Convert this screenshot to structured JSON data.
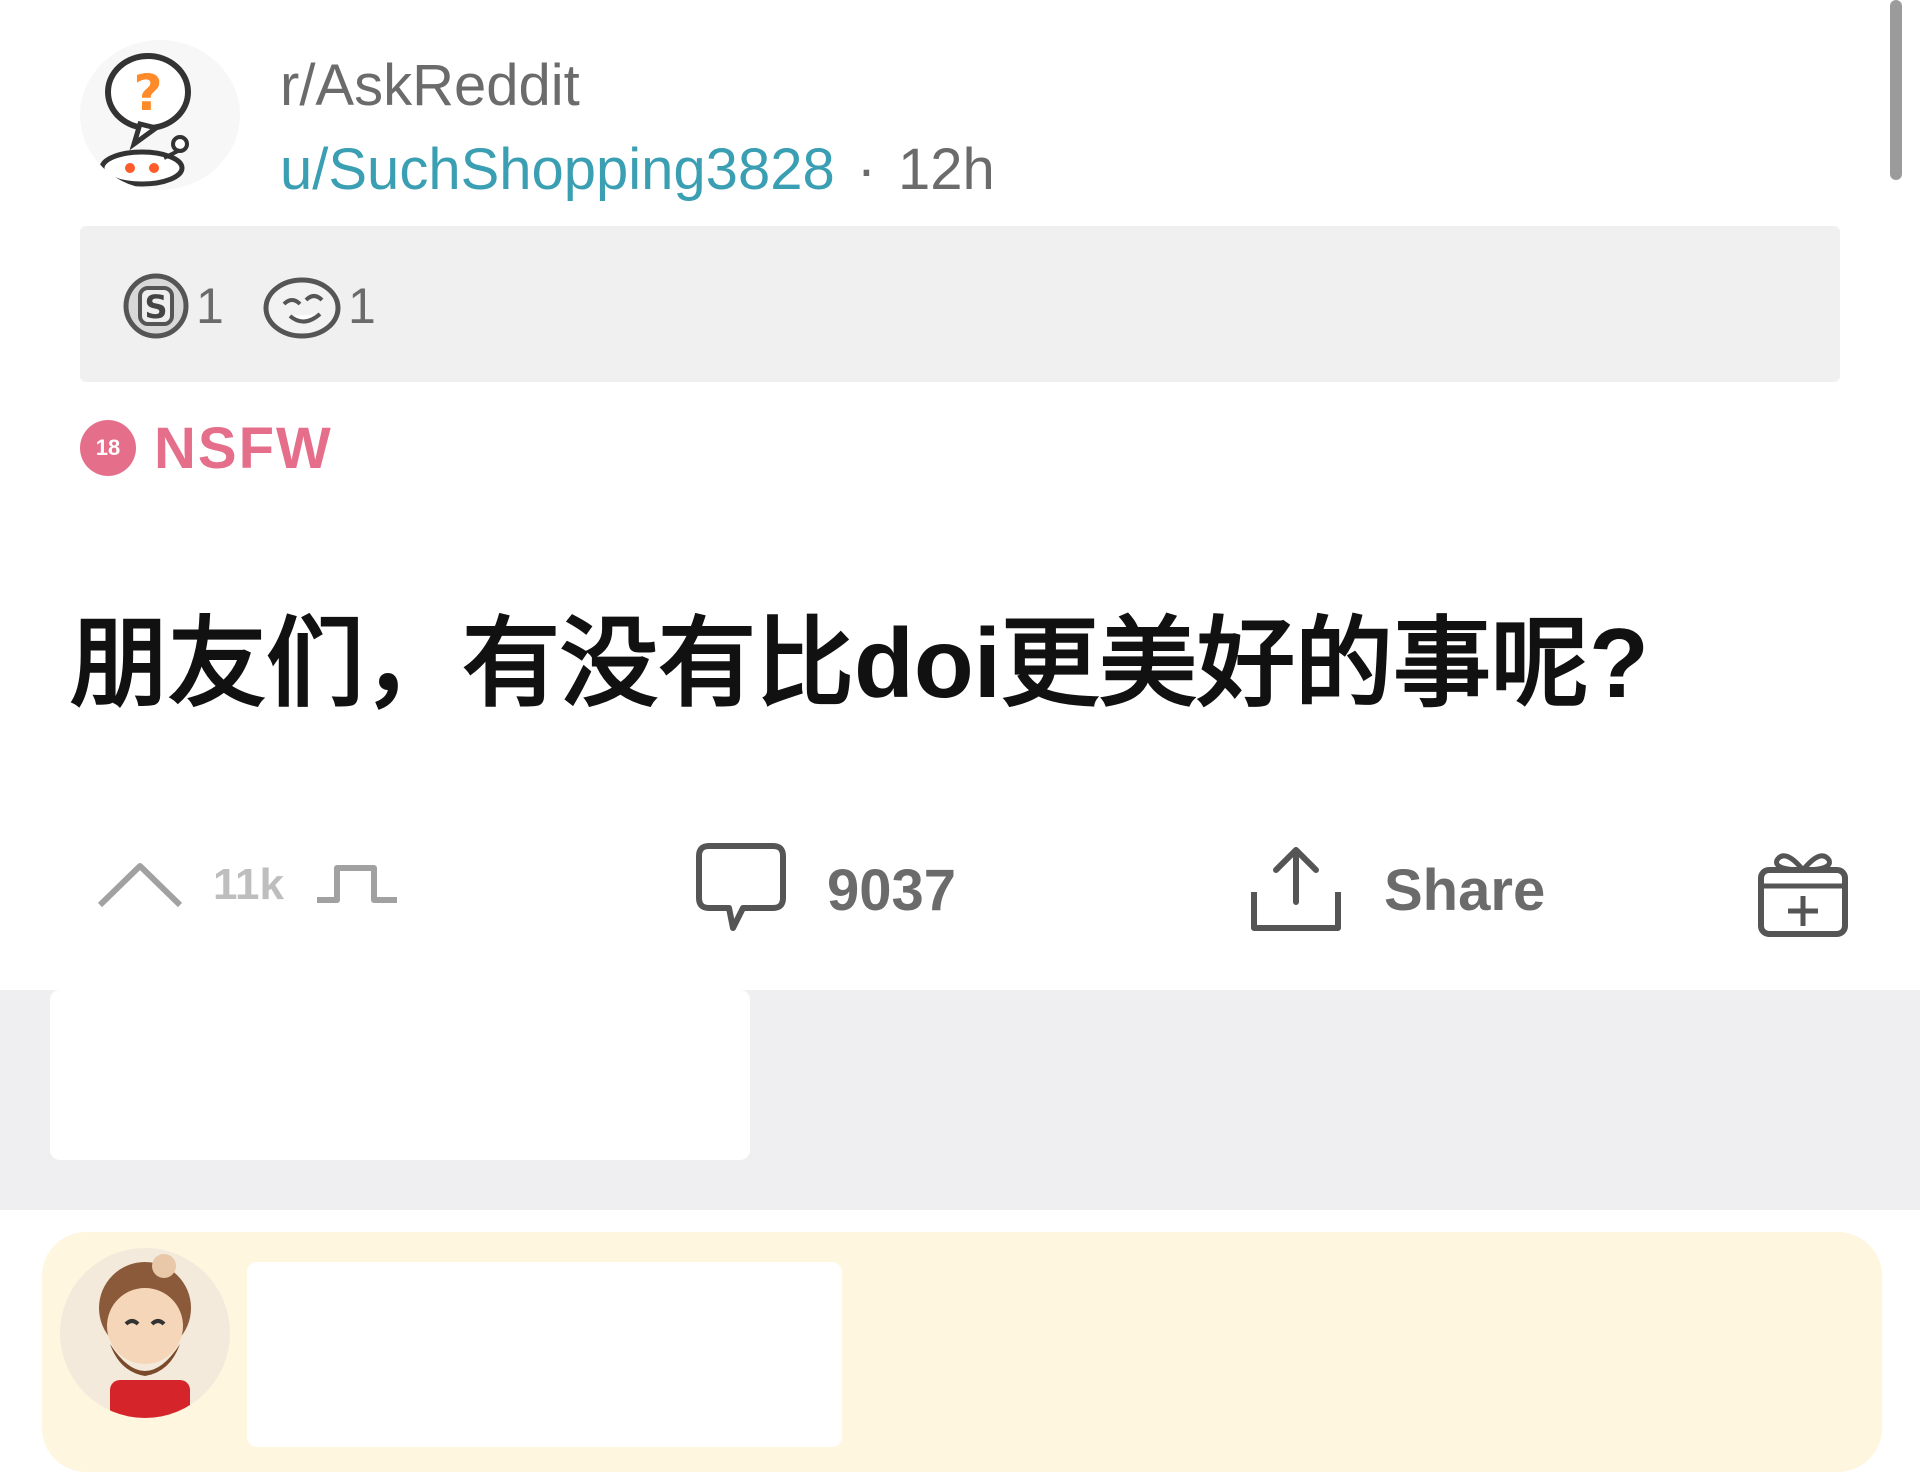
{
  "post": {
    "subreddit": "r/AskReddit",
    "author": "u/SuchShopping3828",
    "separator": "·",
    "age": "12h",
    "nsfw_badge_number": "18",
    "nsfw_label": "NSFW",
    "title": "朋友们，有没有比doi更美好的事呢?"
  },
  "awards": [
    {
      "icon": "silver-award-icon",
      "count": "1"
    },
    {
      "icon": "laughing-award-icon",
      "count": "1"
    }
  ],
  "actions": {
    "upvotes": "11k",
    "comments": "9037",
    "share_label": "Share"
  },
  "icons": {
    "subreddit_avatar": "askreddit-snoo-icon",
    "upvote": "upvote-arrow-icon",
    "downvote": "downvote-arrow-icon",
    "comment": "comment-bubble-icon",
    "share": "share-upload-icon",
    "gift": "gift-award-icon",
    "commenter_avatar": "user-avatar"
  },
  "colors": {
    "username": "#3a9fb2",
    "nsfw": "#e56f8b",
    "muted": "#6b6b6b",
    "comment_card_bg": "#fff6e0"
  }
}
